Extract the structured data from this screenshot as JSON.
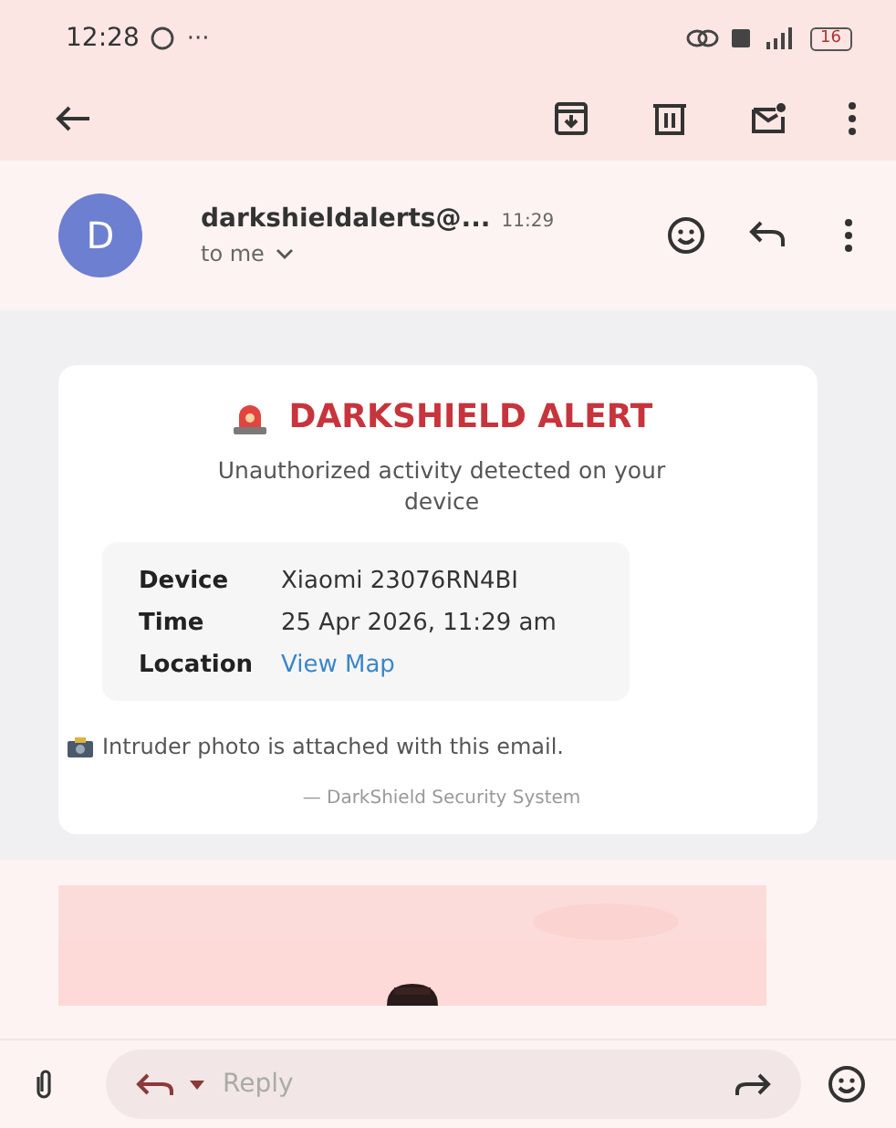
{
  "status_bar": {
    "time": "12:28",
    "more": "···",
    "battery": "16"
  },
  "message": {
    "avatar_letter": "D",
    "sender": "darkshieldalerts@...",
    "time": "11:29",
    "recipient": "to me"
  },
  "alert": {
    "title": "DARKSHIELD ALERT",
    "subtitle": "Unauthorized activity detected on your device",
    "details": [
      {
        "label": "Device",
        "value": "Xiaomi 23076RN4BI",
        "kind": "text"
      },
      {
        "label": "Time",
        "value": "25 Apr 2026, 11:29 am",
        "kind": "text"
      },
      {
        "label": "Location",
        "value": "View Map",
        "kind": "link"
      }
    ],
    "attachment_note": "Intruder photo is attached with this email.",
    "signature": "— DarkShield Security System"
  },
  "reply_bar": {
    "placeholder": "Reply"
  }
}
